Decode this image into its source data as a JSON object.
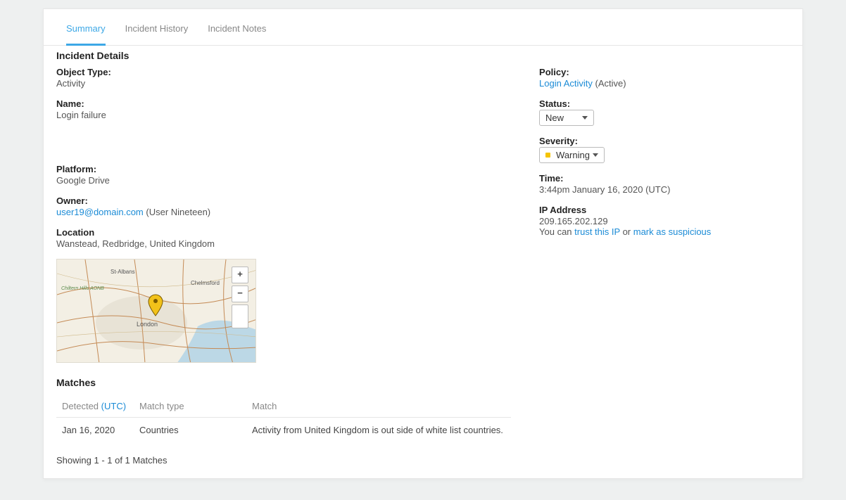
{
  "tabs": {
    "summary": "Summary",
    "history": "Incident History",
    "notes": "Incident Notes"
  },
  "section_title": "Incident Details",
  "left": {
    "object_type_label": "Object Type:",
    "object_type_value": "Activity",
    "name_label": "Name:",
    "name_value": "Login failure",
    "platform_label": "Platform:",
    "platform_value": "Google Drive",
    "owner_label": "Owner:",
    "owner_link": "user19@domain.com",
    "owner_extra": " (User Nineteen)",
    "location_label": "Location",
    "location_value": "Wanstead, Redbridge, United Kingdom"
  },
  "right": {
    "policy_label": "Policy:",
    "policy_link": "Login Activity",
    "policy_extra": " (Active)",
    "status_label": "Status:",
    "status_value": "New",
    "severity_label": "Severity:",
    "severity_value": "Warning",
    "time_label": "Time:",
    "time_value": "3:44pm January 16, 2020 (UTC)",
    "ip_label": "IP Address",
    "ip_value": "209.165.202.129",
    "ip_prefix": "You can ",
    "ip_trust": "trust this IP",
    "ip_or": " or ",
    "ip_suspicious": "mark as suspicious"
  },
  "map": {
    "labels": {
      "london": "London",
      "stalbans": "St-Albans",
      "chelmsford": "Chelmsford",
      "chiltern": "Chiltern Hills AONB"
    },
    "zoom_in": "+",
    "zoom_out": "−"
  },
  "matches": {
    "title": "Matches",
    "col_detected": "Detected ",
    "col_utc": "(UTC)",
    "col_type": "Match type",
    "col_match": "Match",
    "row1_detected": "Jan 16, 2020",
    "row1_type": "Countries",
    "row1_match": "Activity from United Kingdom is out side of white list countries."
  },
  "footer": "Showing 1 - 1 of 1 Matches"
}
